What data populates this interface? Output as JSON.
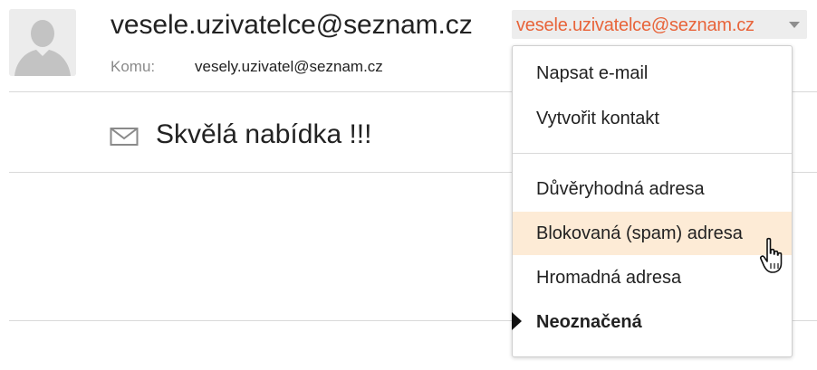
{
  "email": {
    "sender": "vesele.uzivatelce@seznam.cz",
    "to_label": "Komu:",
    "recipient": "vesely.uzivatel@seznam.cz",
    "subject": "Skvělá nabídka !!!"
  },
  "address_dropdown": {
    "address": "vesele.uzivatelce@seznam.cz",
    "accent_color": "#e8643a"
  },
  "menu": {
    "actions": [
      {
        "label": "Napsat e-mail"
      },
      {
        "label": "Vytvořit kontakt"
      }
    ],
    "categories": [
      {
        "label": "Důvěryhodná adresa",
        "hovered": false,
        "selected": false
      },
      {
        "label": "Blokovaná (spam) adresa",
        "hovered": true,
        "selected": false
      },
      {
        "label": "Hromadná adresa",
        "hovered": false,
        "selected": false
      },
      {
        "label": "Neoznačená",
        "hovered": false,
        "selected": true
      }
    ]
  },
  "icons": [
    "avatar-placeholder-icon",
    "envelope-icon",
    "caret-down-icon",
    "hand-pointer-icon",
    "selected-marker-icon"
  ]
}
